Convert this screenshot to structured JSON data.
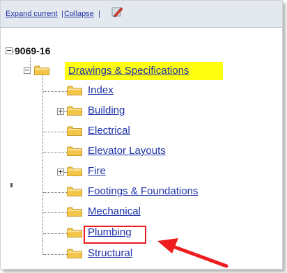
{
  "toolbar": {
    "expand_label": "Expand current",
    "sep1": "|",
    "collapse_label": "Collapse",
    "sep2": "|",
    "edit_icon": "pencil-check-icon"
  },
  "tree": {
    "root": {
      "label": "9069-16",
      "expanded": true
    },
    "drawings": {
      "label": "Drawings & Specifications",
      "expanded": true,
      "highlight_color": "#ffff10"
    },
    "children": [
      {
        "label": "Index",
        "expandable": false
      },
      {
        "label": "Building",
        "expandable": true
      },
      {
        "label": "Electrical",
        "expandable": false
      },
      {
        "label": "Elevator Layouts",
        "expandable": false
      },
      {
        "label": "Fire",
        "expandable": true
      },
      {
        "label": "Footings & Foundations",
        "expandable": false
      },
      {
        "label": "Mechanical",
        "expandable": false
      },
      {
        "label": "Plumbing",
        "expandable": false,
        "annotated": true
      },
      {
        "label": "Structural",
        "expandable": false
      }
    ]
  },
  "annotation": {
    "box_color": "#ee1c1c",
    "arrow_color": "#ee1c1c"
  },
  "colors": {
    "link": "#1f33a8",
    "toolbar_bg": "#e4e9ef",
    "folder": "#f3c64a"
  }
}
